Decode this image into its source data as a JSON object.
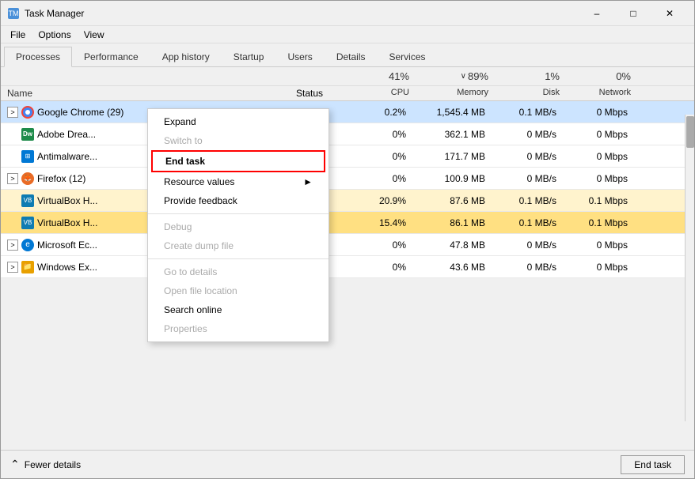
{
  "window": {
    "title": "Task Manager",
    "icon": "⚙"
  },
  "menu": {
    "items": [
      "File",
      "Options",
      "View"
    ]
  },
  "tabs": [
    {
      "id": "processes",
      "label": "Processes",
      "active": true
    },
    {
      "id": "performance",
      "label": "Performance",
      "active": false
    },
    {
      "id": "apphistory",
      "label": "App history",
      "active": false
    },
    {
      "id": "startup",
      "label": "Startup",
      "active": false
    },
    {
      "id": "users",
      "label": "Users",
      "active": false
    },
    {
      "id": "details",
      "label": "Details",
      "active": false
    },
    {
      "id": "services",
      "label": "Services",
      "active": false
    }
  ],
  "stats": {
    "cpu_pct": "41%",
    "mem_pct": "89%",
    "disk_pct": "1%",
    "net_pct": "0%",
    "cpu_label": "CPU",
    "mem_label": "Memory",
    "disk_label": "Disk",
    "net_label": "Network",
    "mem_arrow": "∨"
  },
  "columns": {
    "name": "Name",
    "status": "Status",
    "cpu": "CPU",
    "memory": "Memory",
    "disk": "Disk",
    "network": "Network"
  },
  "rows": [
    {
      "id": 1,
      "name": "Google Chrome (29)",
      "icon_color": "#f44336",
      "icon_char": "●",
      "expandable": true,
      "selected": true,
      "cpu": "0.2%",
      "memory": "1,545.4 MB",
      "disk": "0.1 MB/s",
      "network": "0 Mbps",
      "bg": "selected"
    },
    {
      "id": 2,
      "name": "Adobe Drea...",
      "icon_color": "#1e8b4a",
      "icon_char": "Dw",
      "expandable": false,
      "selected": false,
      "cpu": "0%",
      "memory": "362.1 MB",
      "disk": "0 MB/s",
      "network": "0 Mbps",
      "bg": "normal"
    },
    {
      "id": 3,
      "name": "Antimalware...",
      "icon_color": "#0078d4",
      "icon_char": "⊞",
      "expandable": false,
      "selected": false,
      "cpu": "0%",
      "memory": "171.7 MB",
      "disk": "0 MB/s",
      "network": "0 Mbps",
      "bg": "normal"
    },
    {
      "id": 4,
      "name": "Firefox (12)",
      "icon_color": "#e96b25",
      "icon_char": "🦊",
      "expandable": true,
      "selected": false,
      "cpu": "0%",
      "memory": "100.9 MB",
      "disk": "0 MB/s",
      "network": "0 Mbps",
      "bg": "normal"
    },
    {
      "id": 5,
      "name": "VirtualBox H...",
      "icon_color": "#0e7bb2",
      "icon_char": "VB",
      "expandable": false,
      "selected": false,
      "cpu": "20.9%",
      "memory": "87.6 MB",
      "disk": "0.1 MB/s",
      "network": "0.1 Mbps",
      "bg": "highlight1"
    },
    {
      "id": 6,
      "name": "VirtualBox H...",
      "icon_color": "#0e7bb2",
      "icon_char": "VB",
      "expandable": false,
      "selected": false,
      "cpu": "15.4%",
      "memory": "86.1 MB",
      "disk": "0.1 MB/s",
      "network": "0.1 Mbps",
      "bg": "highlight2"
    },
    {
      "id": 7,
      "name": "Microsoft Ec...",
      "icon_color": "#0078d4",
      "icon_char": "e",
      "expandable": true,
      "selected": false,
      "cpu": "0%",
      "memory": "47.8 MB",
      "disk": "0 MB/s",
      "network": "0 Mbps",
      "bg": "normal"
    },
    {
      "id": 8,
      "name": "Windows Ex...",
      "icon_color": "#e8a000",
      "icon_char": "📁",
      "expandable": true,
      "selected": false,
      "cpu": "0%",
      "memory": "43.6 MB",
      "disk": "0 MB/s",
      "network": "0 Mbps",
      "bg": "normal"
    }
  ],
  "context_menu": {
    "items": [
      {
        "id": "expand",
        "label": "Expand",
        "disabled": false,
        "bold": false,
        "separator_after": false
      },
      {
        "id": "switch",
        "label": "Switch to",
        "disabled": true,
        "bold": false,
        "separator_after": false
      },
      {
        "id": "endtask",
        "label": "End task",
        "disabled": false,
        "bold": true,
        "highlight": "red-border",
        "separator_after": false
      },
      {
        "id": "resource",
        "label": "Resource values",
        "disabled": false,
        "bold": false,
        "has_arrow": true,
        "separator_after": false
      },
      {
        "id": "feedback",
        "label": "Provide feedback",
        "disabled": false,
        "bold": false,
        "separator_after": true
      },
      {
        "id": "debug",
        "label": "Debug",
        "disabled": true,
        "bold": false,
        "separator_after": false
      },
      {
        "id": "dump",
        "label": "Create dump file",
        "disabled": true,
        "bold": false,
        "separator_after": true
      },
      {
        "id": "details",
        "label": "Go to details",
        "disabled": true,
        "bold": false,
        "separator_after": false
      },
      {
        "id": "location",
        "label": "Open file location",
        "disabled": true,
        "bold": false,
        "separator_after": false
      },
      {
        "id": "search",
        "label": "Search online",
        "disabled": false,
        "bold": false,
        "separator_after": false
      },
      {
        "id": "properties",
        "label": "Properties",
        "disabled": true,
        "bold": false,
        "separator_after": false
      }
    ]
  },
  "footer": {
    "fewer_details": "Fewer details",
    "end_task": "End task"
  }
}
